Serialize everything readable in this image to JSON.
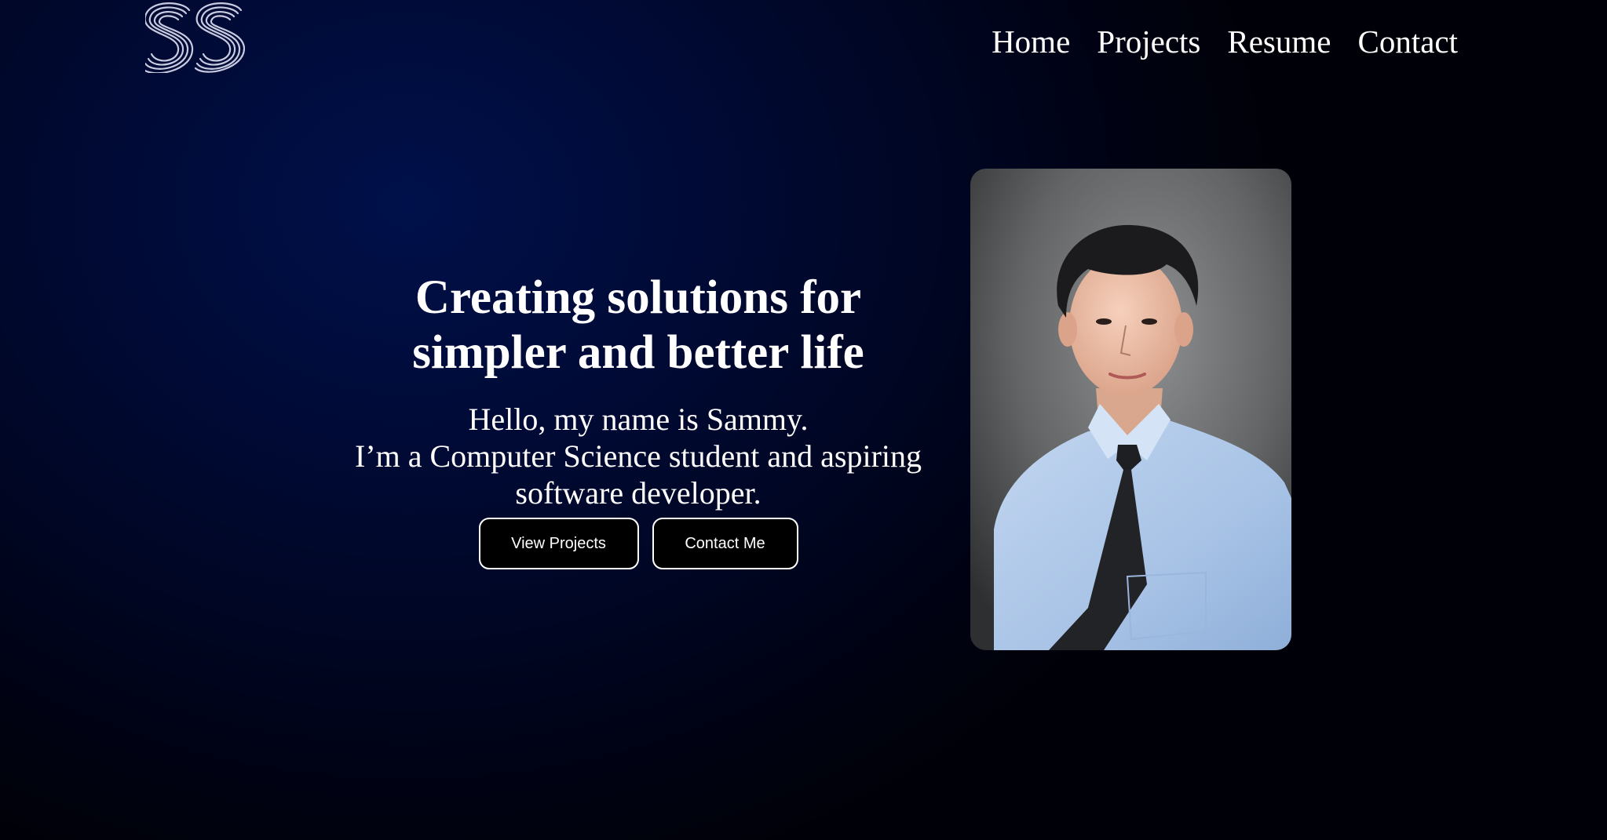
{
  "logo": {
    "text": "SS",
    "icon": "ss-monogram-logo"
  },
  "nav": {
    "items": [
      {
        "label": "Home"
      },
      {
        "label": "Projects"
      },
      {
        "label": "Resume"
      },
      {
        "label": "Contact"
      }
    ]
  },
  "hero": {
    "headline_line1": "Creating solutions for",
    "headline_line2": "simpler and better life",
    "intro_line1": "Hello, my name is Sammy.",
    "intro_line2": "I’m a Computer Science student and aspiring",
    "intro_line3": "software developer.",
    "buttons": {
      "view_projects": "View Projects",
      "contact_me": "Contact Me"
    }
  },
  "photo": {
    "subject": "portrait-photo"
  },
  "colors": {
    "background_center": "#00104a",
    "background_edge": "#000108",
    "text": "#ffffff",
    "button_bg": "#000000",
    "button_border": "#ffffff"
  }
}
